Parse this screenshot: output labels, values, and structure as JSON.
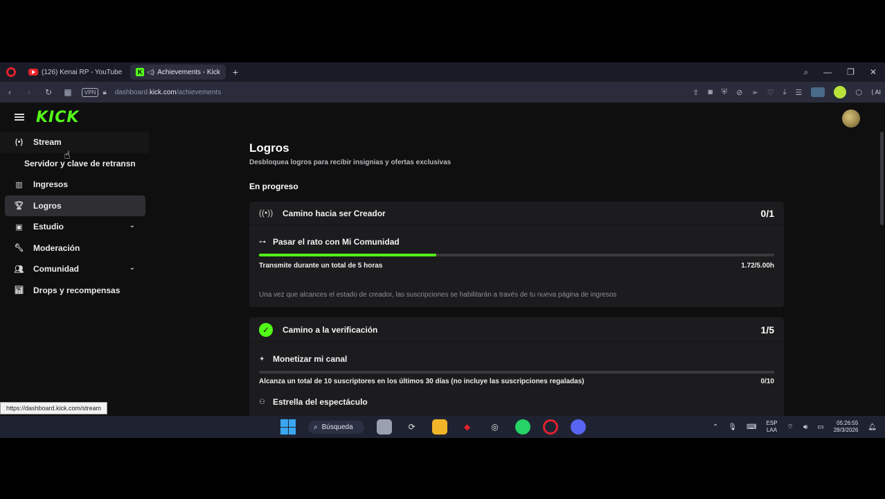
{
  "browser": {
    "tabs": [
      {
        "label": "(126) Kenai RP - YouTube",
        "active": false
      },
      {
        "label": "Achievements - Kick",
        "active": true
      }
    ],
    "address": {
      "vpn_label": "VPN",
      "url_prefix": "dashboard.",
      "url_domain": "kick.com",
      "url_path": "/achievements"
    },
    "ai_label": "AI"
  },
  "sidebar": {
    "items": [
      {
        "label": "Stream",
        "icon": "broadcast-icon"
      },
      {
        "label": "Servidor y clave de retransn",
        "icon": ""
      },
      {
        "label": "Ingresos",
        "icon": "chart-icon"
      },
      {
        "label": "Logros",
        "icon": "trophy-icon"
      },
      {
        "label": "Estudio",
        "icon": "studio-icon"
      },
      {
        "label": "Moderación",
        "icon": "wrench-icon"
      },
      {
        "label": "Comunidad",
        "icon": "people-icon"
      },
      {
        "label": "Drops y recompensas",
        "icon": "stats-icon"
      }
    ]
  },
  "main": {
    "title": "Logros",
    "subtitle": "Desbloquea logros para recibir insignias y ofertas exclusivas",
    "section": "En progreso",
    "cards": [
      {
        "title": "Camino hacia ser Creador",
        "count": "0/1",
        "achievement": "Pasar el rato con Mi Comunidad",
        "progress_label": "Transmite durante un total de 5 horas",
        "progress_value": "1.72/5.00h",
        "progress_fraction": 0.344,
        "note": "Una vez que alcances el estado de creador, las suscripciones se habilitarán a través de tu nueva página de ingresos"
      },
      {
        "title": "Camino a la verificación",
        "count": "1/5",
        "achievement": "Monetizar mi canal",
        "progress_label": "Alcanza un total de 10 suscriptores en los últimos 30 días (no incluye las suscripciones regaladas)",
        "progress_value": "0/10",
        "progress_fraction": 0,
        "achievement2": "Estrella del espectáculo"
      }
    ]
  },
  "status_link": "https://dashboard.kick.com/stream",
  "taskbar": {
    "search_label": "Búsqueda",
    "lang_top": "ESP",
    "lang_bottom": "LAA",
    "time": "05:26:55",
    "date": "28/3/2026"
  },
  "colors": {
    "kick_green": "#53fc18",
    "page_bg": "#0f0f10",
    "card_bg": "#1c1c1e"
  }
}
